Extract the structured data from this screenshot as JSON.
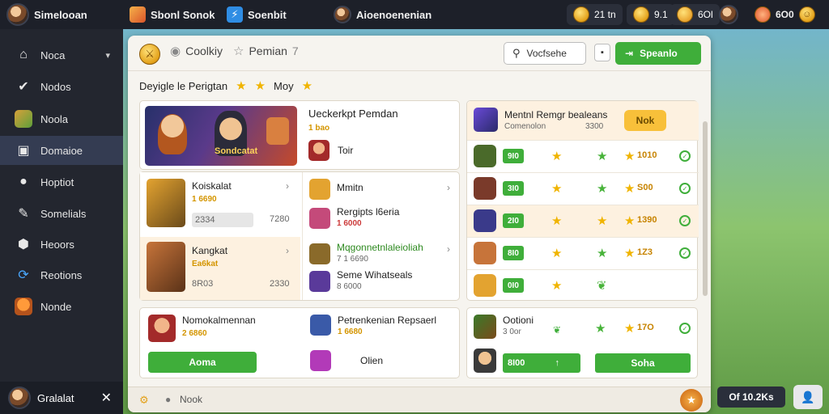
{
  "topbar": {
    "app_title": "Simelooan",
    "items": [
      {
        "label": "Sbonl Sonok",
        "icon": "gallery-icon"
      },
      {
        "label": "Soenbit",
        "icon": "lightning-icon"
      },
      {
        "label": "Aioenoenenian",
        "icon": "avatar-icon"
      }
    ],
    "stats": [
      {
        "value": "21 tn",
        "icon": "coin-icon"
      },
      {
        "value": "9.1",
        "icon": "coin-icon"
      },
      {
        "value": "6Ol",
        "icon": "coin-icon"
      }
    ],
    "right_value": "6O0"
  },
  "sidebar": {
    "items": [
      {
        "label": "Noca",
        "icon": "home-icon",
        "has_chevron": true
      },
      {
        "label": "Nodos",
        "icon": "check-icon"
      },
      {
        "label": "Noola",
        "icon": "mosaic-icon"
      },
      {
        "label": "Domaioe",
        "icon": "gamepad-icon",
        "active": true
      },
      {
        "label": "Hoptiot",
        "icon": "tag-icon"
      },
      {
        "label": "Somelials",
        "icon": "tools-icon"
      },
      {
        "label": "Heoors",
        "icon": "badge-icon"
      },
      {
        "label": "Reotions",
        "icon": "refresh-icon"
      },
      {
        "label": "Nonde",
        "icon": "mushroom-icon"
      }
    ],
    "user": {
      "name": "Gralalat"
    }
  },
  "panel": {
    "tabs": [
      {
        "label": "Coolkiy",
        "icon": "clock-icon"
      },
      {
        "label": "Pemian",
        "icon": "star-outline-icon",
        "suffix": "7"
      }
    ],
    "search_btn": "Vocfsehe",
    "primary_btn": "Speanlo",
    "breadcrumb": {
      "title": "Deyigle le Perigtan",
      "extra": "Moy"
    }
  },
  "featured": {
    "banner_text": "Sondcatat",
    "title": "Ueckerkpt Pemdan",
    "sub": "1 bao",
    "item_label": "Toir"
  },
  "left_cards": [
    {
      "title": "Koiskalat",
      "sub": "1 6690",
      "meta": "2334",
      "value": "7280"
    },
    {
      "title": "Kangkat",
      "sub": "Ea6kat",
      "meta": "8R03",
      "value": "2330"
    }
  ],
  "mid_list": [
    {
      "title": "Mmitn",
      "sub": ""
    },
    {
      "title": "Rergipts l6eria",
      "sub": "1 6000"
    },
    {
      "title": "Mqgonnetnlaleioliah",
      "sub": "7 1 6690"
    },
    {
      "title": "Seme Wihatseals",
      "sub": "8 6000"
    }
  ],
  "bottom_left": {
    "title": "Nomokalmennan",
    "sub": "2 6860",
    "button": "Aoma",
    "title2": "Petrenkenian Repsaerl",
    "sub2": "1 6680",
    "action2": "Olien"
  },
  "ranking": {
    "header_title": "Mentnl Remgr bealeans",
    "header_sub": "Comenolon",
    "header_val": "3300",
    "header_btn": "Nok",
    "rows": [
      {
        "badge": "9I0",
        "value": "1010"
      },
      {
        "badge": "3I0",
        "value": "S00"
      },
      {
        "badge": "2I0",
        "value": "1390"
      },
      {
        "badge": "8I0",
        "value": "1Z3"
      },
      {
        "badge": "0I0",
        "value": ""
      }
    ],
    "footer": {
      "title": "Ootioni",
      "sub": "3 0or",
      "value": "17O",
      "badge": "8I00",
      "button": "Soha"
    }
  },
  "bottom_bar": {
    "label": "Nook"
  },
  "corner_pill": "Of 10.2Ks"
}
